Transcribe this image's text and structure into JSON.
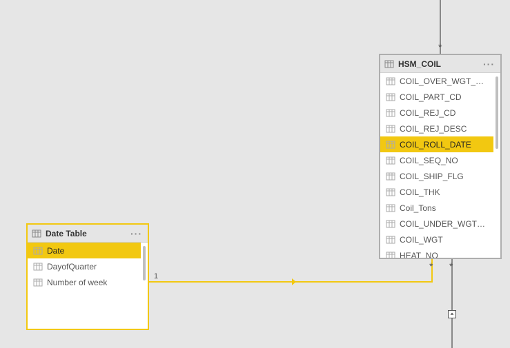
{
  "tables": {
    "dateTable": {
      "title": "Date Table",
      "fields": [
        {
          "label": "Date",
          "selected": true
        },
        {
          "label": "DayofQuarter",
          "selected": false
        },
        {
          "label": "Number of week",
          "selected": false
        }
      ]
    },
    "hsmCoil": {
      "title": "HSM_COIL",
      "fields": [
        {
          "label": "COIL_OVER_WGT_FLG",
          "selected": false
        },
        {
          "label": "COIL_PART_CD",
          "selected": false
        },
        {
          "label": "COIL_REJ_CD",
          "selected": false
        },
        {
          "label": "COIL_REJ_DESC",
          "selected": false
        },
        {
          "label": "COIL_ROLL_DATE",
          "selected": true
        },
        {
          "label": "COIL_SEQ_NO",
          "selected": false
        },
        {
          "label": "COIL_SHIP_FLG",
          "selected": false
        },
        {
          "label": "COIL_THK",
          "selected": false
        },
        {
          "label": "Coil_Tons",
          "selected": false
        },
        {
          "label": "COIL_UNDER_WGT_FLG",
          "selected": false
        },
        {
          "label": "COIL_WGT",
          "selected": false
        },
        {
          "label": "HEAT_NO",
          "selected": false
        }
      ]
    }
  },
  "relationship": {
    "fromCardinality": "1",
    "toCardinalityTopA": "*",
    "toCardinalityTopB": "*",
    "toCardinalityBottom": "*"
  }
}
